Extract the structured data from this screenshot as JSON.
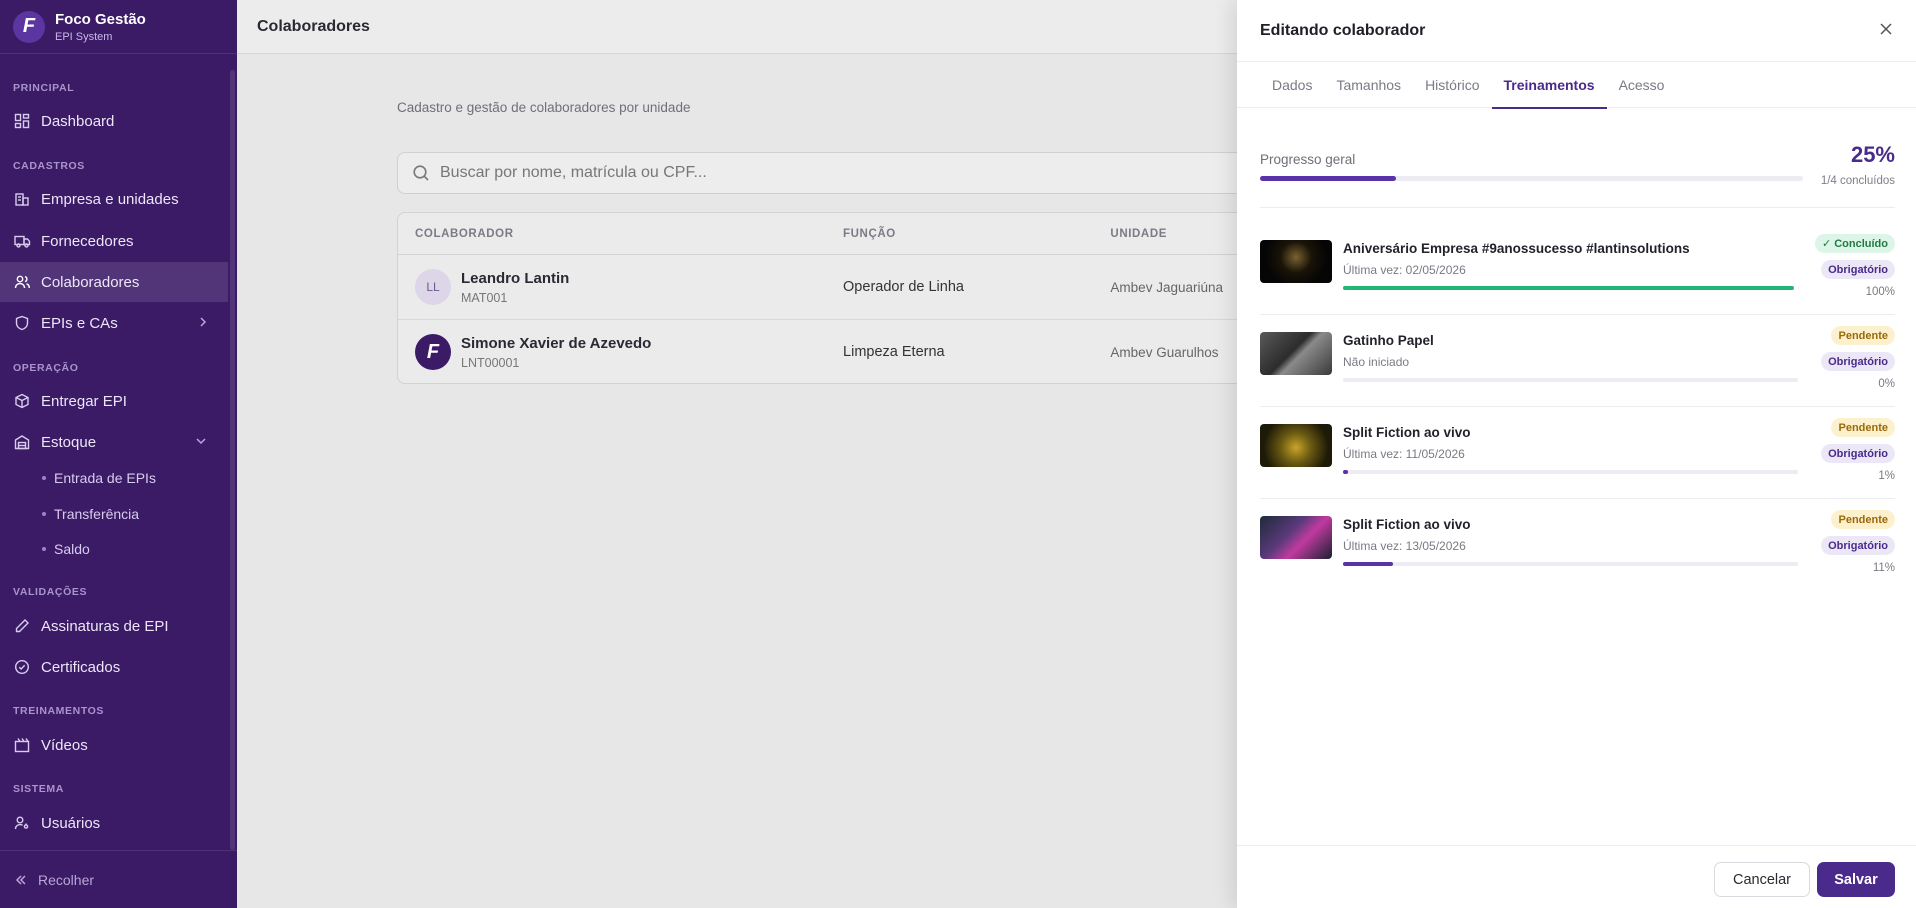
{
  "brand": {
    "name": "Foco Gestão",
    "subtitle": "EPI System",
    "logo_letter": "F"
  },
  "sidebar": {
    "sections": {
      "principal": "PRINCIPAL",
      "cadastros": "CADASTROS",
      "operacao": "OPERAÇÃO",
      "validacoes": "VALIDAÇÕES",
      "treinamentos": "TREINAMENTOS",
      "sistema": "SISTEMA"
    },
    "items": {
      "dashboard": "Dashboard",
      "empresa": "Empresa e unidades",
      "fornecedores": "Fornecedores",
      "colaboradores": "Colaboradores",
      "epis": "EPIs e CAs",
      "entregar": "Entregar EPI",
      "estoque": "Estoque",
      "entrada": "Entrada de EPIs",
      "transferencia": "Transferência",
      "saldo": "Saldo",
      "assinaturas": "Assinaturas de EPI",
      "certificados": "Certificados",
      "videos": "Vídeos",
      "usuarios": "Usuários"
    },
    "active_item": "colaboradores",
    "collapse_label": "Recolher"
  },
  "main": {
    "title": "Colaboradores",
    "subtitle": "Cadastro e gestão de colaboradores por unidade",
    "search_placeholder": "Buscar por nome, matrícula ou CPF...",
    "table": {
      "headers": [
        "COLABORADOR",
        "FUNÇÃO",
        "UNIDADE"
      ],
      "rows": [
        {
          "initials": "LL",
          "name": "Leandro Lantin",
          "matricula": "MAT001",
          "funcao": "Operador de Linha",
          "unidade": "Ambev Jaguariúna"
        },
        {
          "initials": "F",
          "name": "Simone Xavier de Azevedo",
          "matricula": "LNT00001",
          "funcao": "Limpeza Eterna",
          "unidade": "Ambev Guarulhos"
        }
      ]
    }
  },
  "drawer": {
    "title": "Editando colaborador",
    "tabs": [
      "Dados",
      "Tamanhos",
      "Histórico",
      "Treinamentos",
      "Acesso"
    ],
    "active_tab": "Treinamentos",
    "progress": {
      "label": "Progresso geral",
      "percent_text": "25%",
      "percent_value": 25,
      "count_text": "1/4 concluídos"
    },
    "trainings": [
      {
        "title": "Aniversário Empresa #9anossucesso #lantinsolutions",
        "subtitle": "Última vez: 02/05/2026",
        "status": "✓ Concluído",
        "status_kind": "done",
        "required": "Obrigatório",
        "percent_text": "100%",
        "progress": 100,
        "bar_color": "#22b573"
      },
      {
        "title": "Gatinho Papel",
        "subtitle": "Não iniciado",
        "status": "Pendente",
        "status_kind": "pending",
        "required": "Obrigatório",
        "percent_text": "0%",
        "progress": 0,
        "bar_color": "#5a33a8"
      },
      {
        "title": "Split Fiction ao vivo",
        "subtitle": "Última vez: 11/05/2026",
        "status": "Pendente",
        "status_kind": "pending",
        "required": "Obrigatório",
        "percent_text": "1%",
        "progress": 1,
        "bar_color": "#5a33a8"
      },
      {
        "title": "Split Fiction ao vivo",
        "subtitle": "Última vez: 13/05/2026",
        "status": "Pendente",
        "status_kind": "pending",
        "required": "Obrigatório",
        "percent_text": "11%",
        "progress": 11,
        "bar_color": "#5a33a8"
      }
    ],
    "buttons": {
      "cancel": "Cancelar",
      "save": "Salvar"
    }
  },
  "colors": {
    "sidebar_bg": "#3b1a66",
    "accent": "#4a2a8a",
    "success": "#22b573",
    "pending": "#fdf0cc"
  }
}
